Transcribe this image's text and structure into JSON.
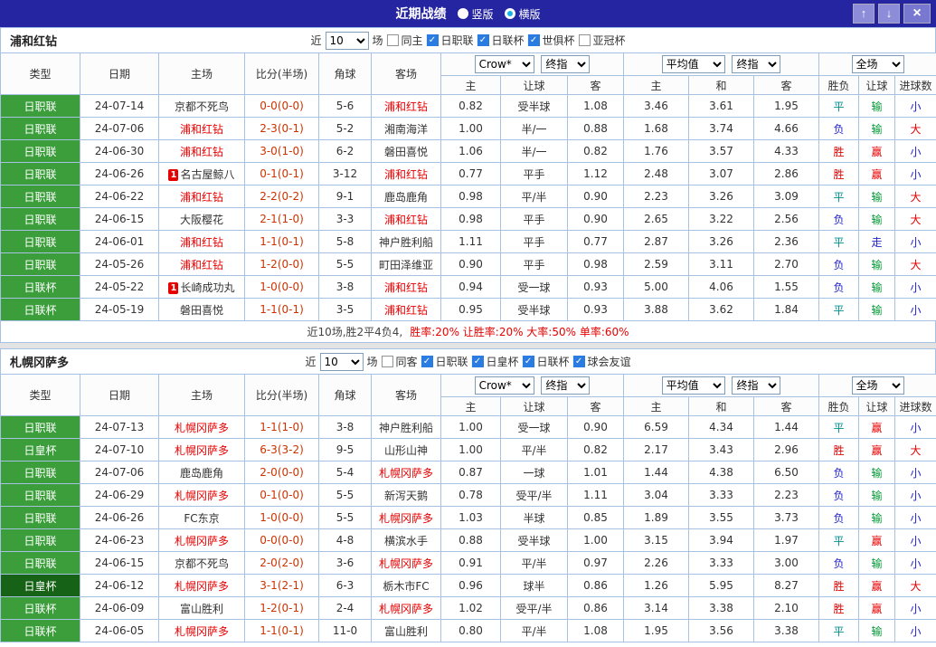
{
  "titlebar": {
    "title": "近期战绩",
    "view_options": [
      {
        "label": "竖版",
        "selected": false
      },
      {
        "label": "横版",
        "selected": true
      }
    ],
    "up_icon": "↑",
    "down_icon": "↓",
    "close_icon": "×"
  },
  "icons": {
    "check": "✓"
  },
  "labels": {
    "near": "近",
    "games": "场"
  },
  "dropdowns": {
    "count": "10",
    "provider": "Crow*",
    "stage": "终指",
    "average": "平均值",
    "scope": "全场"
  },
  "headers": {
    "main": [
      "类型",
      "日期",
      "主场",
      "比分(半场)",
      "角球",
      "客场"
    ],
    "sub": [
      "主",
      "让球",
      "客",
      "主",
      "和",
      "客",
      "胜负",
      "让球",
      "进球数"
    ]
  },
  "colors": {
    "titlebar_bg": "#2525a2",
    "league_green": "#3b9e3b",
    "league_dark_green": "#166216",
    "focus_team_red": "#e60000",
    "score_red": "#cc3300",
    "checkbox_blue": "#2b7ce0",
    "grid_border_blue": "#a6c1e1"
  },
  "result_colors": {
    "胜": "#e60000",
    "平": "#009090",
    "负": "#2323cc",
    "赢": "#e60000",
    "输": "#009933",
    "走": "#2323cc",
    "大": "#e60000",
    "小": "#2323cc"
  },
  "tables": [
    {
      "team": "浦和红钻",
      "filters": [
        {
          "label": "同主",
          "checked": false
        },
        {
          "label": "日职联",
          "checked": true
        },
        {
          "label": "日联杯",
          "checked": true
        },
        {
          "label": "世俱杯",
          "checked": true
        },
        {
          "label": "亚冠杯",
          "checked": false
        }
      ],
      "rows": [
        {
          "league": "日职联",
          "league_bg": "#3b9e3b",
          "date": "24-07-14",
          "home": "京都不死鸟",
          "home_focus": false,
          "home_badge": null,
          "score": "0-0(0-0)",
          "corners": "5-6",
          "away": "浦和红钻",
          "away_focus": true,
          "away_badge": null,
          "odds": [
            "0.82",
            "受半球",
            "1.08"
          ],
          "avg": [
            "3.46",
            "3.61",
            "1.95"
          ],
          "results": [
            "平",
            "输",
            "小"
          ]
        },
        {
          "league": "日职联",
          "league_bg": "#3b9e3b",
          "date": "24-07-06",
          "home": "浦和红钻",
          "home_focus": true,
          "home_badge": null,
          "score": "2-3(0-1)",
          "corners": "5-2",
          "away": "湘南海洋",
          "away_focus": false,
          "away_badge": null,
          "odds": [
            "1.00",
            "半/一",
            "0.88"
          ],
          "avg": [
            "1.68",
            "3.74",
            "4.66"
          ],
          "results": [
            "负",
            "输",
            "大"
          ]
        },
        {
          "league": "日职联",
          "league_bg": "#3b9e3b",
          "date": "24-06-30",
          "home": "浦和红钻",
          "home_focus": true,
          "home_badge": null,
          "score": "3-0(1-0)",
          "corners": "6-2",
          "away": "磐田喜悦",
          "away_focus": false,
          "away_badge": null,
          "odds": [
            "1.06",
            "半/一",
            "0.82"
          ],
          "avg": [
            "1.76",
            "3.57",
            "4.33"
          ],
          "results": [
            "胜",
            "赢",
            "小"
          ]
        },
        {
          "league": "日职联",
          "league_bg": "#3b9e3b",
          "date": "24-06-26",
          "home": "名古屋鲸八",
          "home_focus": false,
          "home_badge": "1",
          "score": "0-1(0-1)",
          "corners": "3-12",
          "away": "浦和红钻",
          "away_focus": true,
          "away_badge": null,
          "odds": [
            "0.77",
            "平手",
            "1.12"
          ],
          "avg": [
            "2.48",
            "3.07",
            "2.86"
          ],
          "results": [
            "胜",
            "赢",
            "小"
          ]
        },
        {
          "league": "日职联",
          "league_bg": "#3b9e3b",
          "date": "24-06-22",
          "home": "浦和红钻",
          "home_focus": true,
          "home_badge": null,
          "score": "2-2(0-2)",
          "corners": "9-1",
          "away": "鹿岛鹿角",
          "away_focus": false,
          "away_badge": null,
          "odds": [
            "0.98",
            "平/半",
            "0.90"
          ],
          "avg": [
            "2.23",
            "3.26",
            "3.09"
          ],
          "results": [
            "平",
            "输",
            "大"
          ]
        },
        {
          "league": "日职联",
          "league_bg": "#3b9e3b",
          "date": "24-06-15",
          "home": "大阪樱花",
          "home_focus": false,
          "home_badge": null,
          "score": "2-1(1-0)",
          "corners": "3-3",
          "away": "浦和红钻",
          "away_focus": true,
          "away_badge": null,
          "odds": [
            "0.98",
            "平手",
            "0.90"
          ],
          "avg": [
            "2.65",
            "3.22",
            "2.56"
          ],
          "results": [
            "负",
            "输",
            "大"
          ]
        },
        {
          "league": "日职联",
          "league_bg": "#3b9e3b",
          "date": "24-06-01",
          "home": "浦和红钻",
          "home_focus": true,
          "home_badge": null,
          "score": "1-1(0-1)",
          "corners": "5-8",
          "away": "神户胜利船",
          "away_focus": false,
          "away_badge": null,
          "odds": [
            "1.11",
            "平手",
            "0.77"
          ],
          "avg": [
            "2.87",
            "3.26",
            "2.36"
          ],
          "results": [
            "平",
            "走",
            "小"
          ]
        },
        {
          "league": "日职联",
          "league_bg": "#3b9e3b",
          "date": "24-05-26",
          "home": "浦和红钻",
          "home_focus": true,
          "home_badge": null,
          "score": "1-2(0-0)",
          "corners": "5-5",
          "away": "町田泽维亚",
          "away_focus": false,
          "away_badge": null,
          "odds": [
            "0.90",
            "平手",
            "0.98"
          ],
          "avg": [
            "2.59",
            "3.11",
            "2.70"
          ],
          "results": [
            "负",
            "输",
            "大"
          ]
        },
        {
          "league": "日联杯",
          "league_bg": "#3b9e3b",
          "date": "24-05-22",
          "home": "长崎成功丸",
          "home_focus": false,
          "home_badge": "1",
          "score": "1-0(0-0)",
          "corners": "3-8",
          "away": "浦和红钻",
          "away_focus": true,
          "away_badge": null,
          "odds": [
            "0.94",
            "受一球",
            "0.93"
          ],
          "avg": [
            "5.00",
            "4.06",
            "1.55"
          ],
          "results": [
            "负",
            "输",
            "小"
          ]
        },
        {
          "league": "日联杯",
          "league_bg": "#3b9e3b",
          "date": "24-05-19",
          "home": "磐田喜悦",
          "home_focus": false,
          "home_badge": null,
          "score": "1-1(0-1)",
          "corners": "3-5",
          "away": "浦和红钻",
          "away_focus": true,
          "away_badge": null,
          "odds": [
            "0.95",
            "受半球",
            "0.93"
          ],
          "avg": [
            "3.88",
            "3.62",
            "1.84"
          ],
          "results": [
            "平",
            "输",
            "小"
          ]
        }
      ],
      "summary": {
        "prefix": "近10场,胜2平4负4,",
        "stats": "胜率:20% 让胜率:20% 大率:50% 单率:60%"
      }
    },
    {
      "team": "札幌冈萨多",
      "filters": [
        {
          "label": "同客",
          "checked": false
        },
        {
          "label": "日职联",
          "checked": true
        },
        {
          "label": "日皇杯",
          "checked": true
        },
        {
          "label": "日联杯",
          "checked": true
        },
        {
          "label": "球会友谊",
          "checked": true
        }
      ],
      "rows": [
        {
          "league": "日职联",
          "league_bg": "#3b9e3b",
          "date": "24-07-13",
          "home": "札幌冈萨多",
          "home_focus": true,
          "home_badge": null,
          "score": "1-1(1-0)",
          "corners": "3-8",
          "away": "神户胜利船",
          "away_focus": false,
          "away_badge": null,
          "odds": [
            "1.00",
            "受一球",
            "0.90"
          ],
          "avg": [
            "6.59",
            "4.34",
            "1.44"
          ],
          "results": [
            "平",
            "赢",
            "小"
          ]
        },
        {
          "league": "日皇杯",
          "league_bg": "#3b9e3b",
          "date": "24-07-10",
          "home": "札幌冈萨多",
          "home_focus": true,
          "home_badge": null,
          "score": "6-3(3-2)",
          "corners": "9-5",
          "away": "山形山神",
          "away_focus": false,
          "away_badge": null,
          "odds": [
            "1.00",
            "平/半",
            "0.82"
          ],
          "avg": [
            "2.17",
            "3.43",
            "2.96"
          ],
          "results": [
            "胜",
            "赢",
            "大"
          ]
        },
        {
          "league": "日职联",
          "league_bg": "#3b9e3b",
          "date": "24-07-06",
          "home": "鹿岛鹿角",
          "home_focus": false,
          "home_badge": null,
          "score": "2-0(0-0)",
          "corners": "5-4",
          "away": "札幌冈萨多",
          "away_focus": true,
          "away_badge": null,
          "odds": [
            "0.87",
            "一球",
            "1.01"
          ],
          "avg": [
            "1.44",
            "4.38",
            "6.50"
          ],
          "results": [
            "负",
            "输",
            "小"
          ]
        },
        {
          "league": "日职联",
          "league_bg": "#3b9e3b",
          "date": "24-06-29",
          "home": "札幌冈萨多",
          "home_focus": true,
          "home_badge": null,
          "score": "0-1(0-0)",
          "corners": "5-5",
          "away": "新泻天鹅",
          "away_focus": false,
          "away_badge": null,
          "odds": [
            "0.78",
            "受平/半",
            "1.11"
          ],
          "avg": [
            "3.04",
            "3.33",
            "2.23"
          ],
          "results": [
            "负",
            "输",
            "小"
          ]
        },
        {
          "league": "日职联",
          "league_bg": "#3b9e3b",
          "date": "24-06-26",
          "home": "FC东京",
          "home_focus": false,
          "home_badge": null,
          "score": "1-0(0-0)",
          "corners": "5-5",
          "away": "札幌冈萨多",
          "away_focus": true,
          "away_badge": null,
          "odds": [
            "1.03",
            "半球",
            "0.85"
          ],
          "avg": [
            "1.89",
            "3.55",
            "3.73"
          ],
          "results": [
            "负",
            "输",
            "小"
          ]
        },
        {
          "league": "日职联",
          "league_bg": "#3b9e3b",
          "date": "24-06-23",
          "home": "札幌冈萨多",
          "home_focus": true,
          "home_badge": null,
          "score": "0-0(0-0)",
          "corners": "4-8",
          "away": "横滨水手",
          "away_focus": false,
          "away_badge": null,
          "odds": [
            "0.88",
            "受半球",
            "1.00"
          ],
          "avg": [
            "3.15",
            "3.94",
            "1.97"
          ],
          "results": [
            "平",
            "赢",
            "小"
          ]
        },
        {
          "league": "日职联",
          "league_bg": "#3b9e3b",
          "date": "24-06-15",
          "home": "京都不死鸟",
          "home_focus": false,
          "home_badge": null,
          "score": "2-0(2-0)",
          "corners": "3-6",
          "away": "札幌冈萨多",
          "away_focus": true,
          "away_badge": null,
          "odds": [
            "0.91",
            "平/半",
            "0.97"
          ],
          "avg": [
            "2.26",
            "3.33",
            "3.00"
          ],
          "results": [
            "负",
            "输",
            "小"
          ]
        },
        {
          "league": "日皇杯",
          "league_bg": "#166216",
          "date": "24-06-12",
          "home": "札幌冈萨多",
          "home_focus": true,
          "home_badge": null,
          "score": "3-1(2-1)",
          "corners": "6-3",
          "away": "栃木市FC",
          "away_focus": false,
          "away_badge": null,
          "odds": [
            "0.96",
            "球半",
            "0.86"
          ],
          "avg": [
            "1.26",
            "5.95",
            "8.27"
          ],
          "results": [
            "胜",
            "赢",
            "大"
          ]
        },
        {
          "league": "日联杯",
          "league_bg": "#3b9e3b",
          "date": "24-06-09",
          "home": "富山胜利",
          "home_focus": false,
          "home_badge": null,
          "score": "1-2(0-1)",
          "corners": "2-4",
          "away": "札幌冈萨多",
          "away_focus": true,
          "away_badge": null,
          "odds": [
            "1.02",
            "受平/半",
            "0.86"
          ],
          "avg": [
            "3.14",
            "3.38",
            "2.10"
          ],
          "results": [
            "胜",
            "赢",
            "小"
          ]
        },
        {
          "league": "日联杯",
          "league_bg": "#3b9e3b",
          "date": "24-06-05",
          "home": "札幌冈萨多",
          "home_focus": true,
          "home_badge": null,
          "score": "1-1(0-1)",
          "corners": "11-0",
          "away": "富山胜利",
          "away_focus": false,
          "away_badge": null,
          "odds": [
            "0.80",
            "平/半",
            "1.08"
          ],
          "avg": [
            "1.95",
            "3.56",
            "3.38"
          ],
          "results": [
            "平",
            "输",
            "小"
          ]
        }
      ]
    }
  ]
}
